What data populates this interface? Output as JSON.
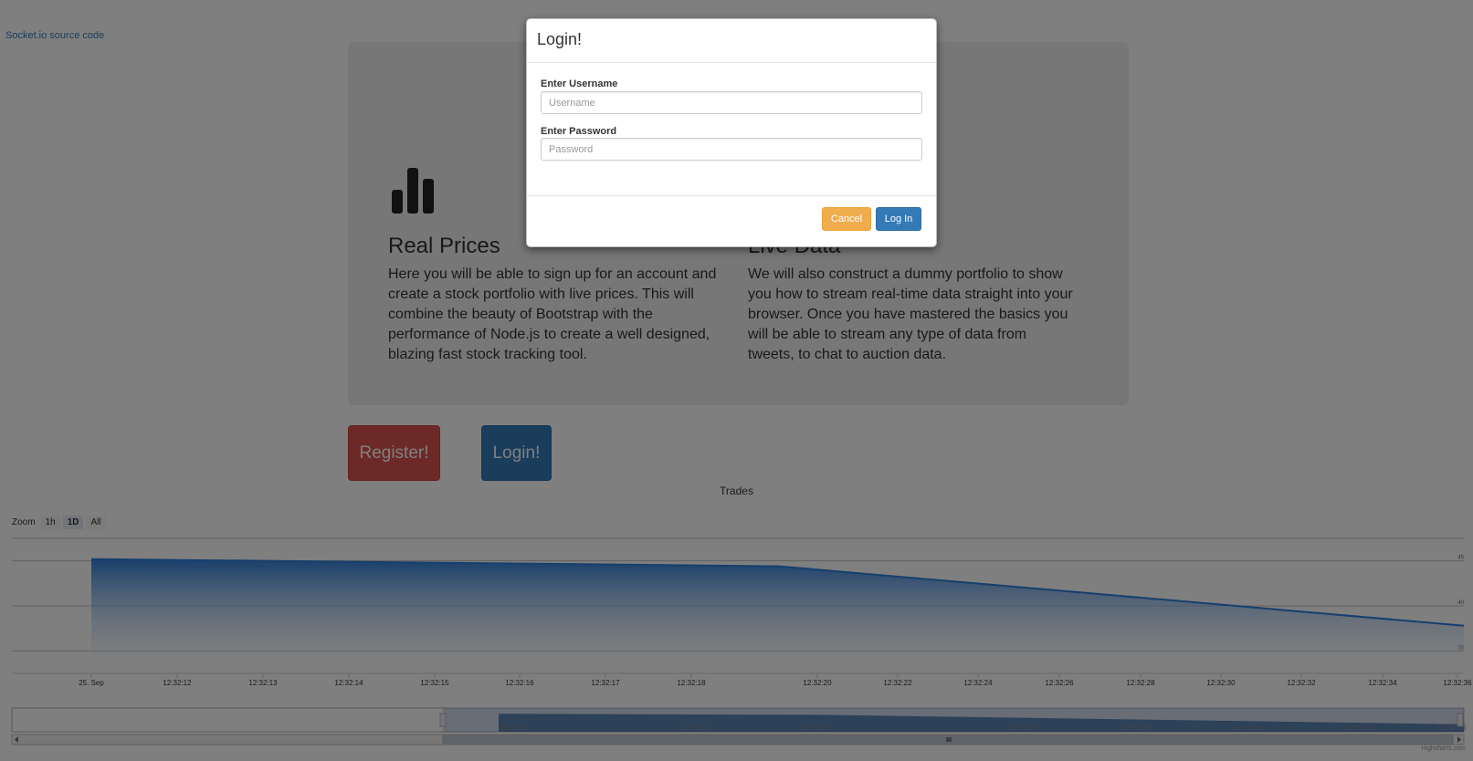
{
  "page": {
    "source_link": "Socket.io source code"
  },
  "features": [
    {
      "title": "Real Prices",
      "text": "Here you will be able to sign up for an account and create a stock portfolio with live prices. This will combine the beauty of Bootstrap with the performance of Node.js to create a well designed, blazing fast stock tracking tool."
    },
    {
      "title": "Live Data",
      "text": "We will also construct a dummy portfolio to show you how to stream real-time data straight into your browser. Once you have mastered the basics you will be able to stream any type of data from tweets, to chat to auction data."
    }
  ],
  "buttons": {
    "register": "Register!",
    "login": "Login!"
  },
  "chart": {
    "title": "Trades",
    "zoom_label": "Zoom",
    "zoom_options": [
      "1h",
      "1D",
      "All"
    ],
    "zoom_selected": "1D",
    "credit": "Highcharts.com"
  },
  "chart_data": {
    "type": "area",
    "title": "Trades",
    "x": [
      "25. Sep",
      "12:32:19",
      "12:32:36"
    ],
    "values": [
      45.2,
      44.4,
      37.8
    ],
    "ylim": [
      32.5,
      47.5
    ],
    "y_ticks": [
      35,
      40,
      45
    ],
    "x_tick_labels": [
      "25. Sep",
      "12:32:12",
      "12:32:13",
      "12:32:14",
      "12:32:15",
      "12:32:16",
      "12:32:17",
      "12:32:18",
      "12:32:20",
      "12:32:22",
      "12:32:24",
      "12:32:26",
      "12:32:28",
      "12:32:30",
      "12:32:32",
      "12:32:34",
      "12:32:36"
    ],
    "navigator_tick_labels": [
      "25. Sep",
      "12:32:14",
      "12:32:16",
      "12:32:20",
      "12:32:24",
      "12:32:28",
      "12:32:32",
      "12:32:36"
    ],
    "grid": true,
    "color": "#2f7ed8"
  },
  "modal": {
    "title": "Login!",
    "username_label": "Enter Username",
    "username_placeholder": "Username",
    "password_label": "Enter Password",
    "password_placeholder": "Password",
    "cancel": "Cancel",
    "login": "Log In"
  }
}
